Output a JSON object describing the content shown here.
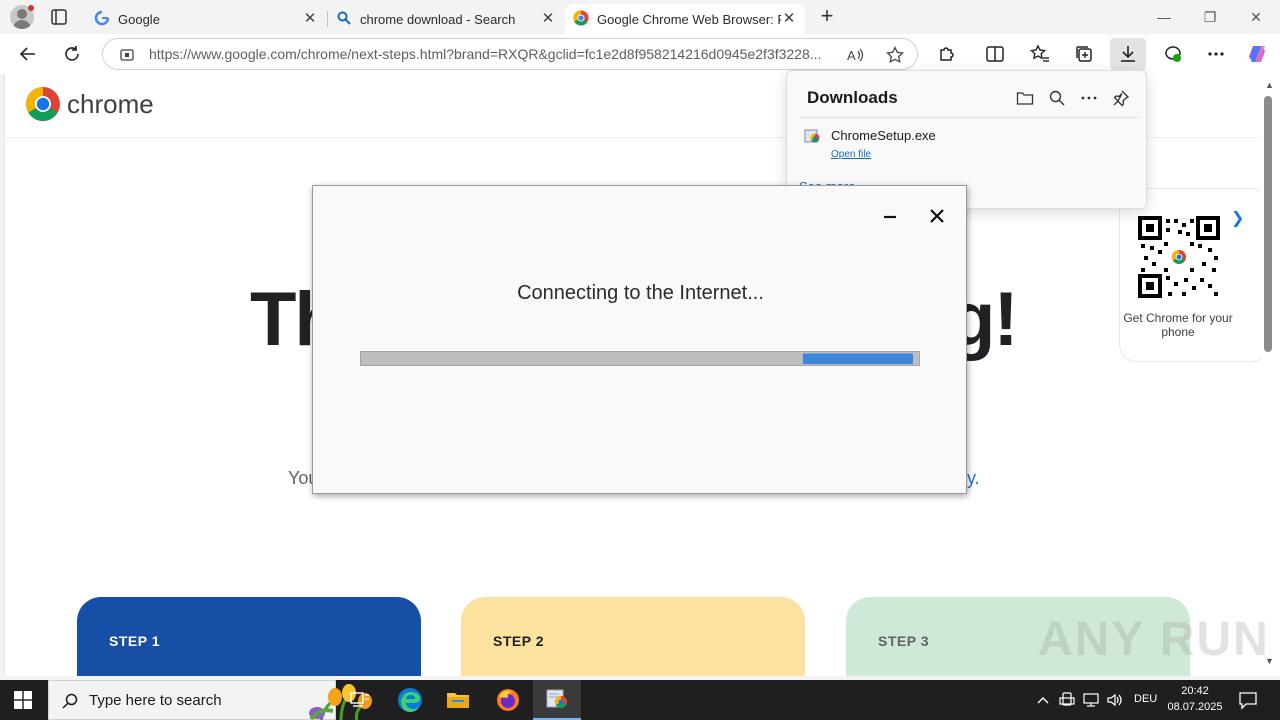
{
  "tabs": [
    {
      "title": "Google",
      "favicon": "google-g-icon",
      "active": false
    },
    {
      "title": "chrome download - Search",
      "favicon": "bing-search-icon",
      "active": false
    },
    {
      "title": "Google Chrome Web Browser: Fir",
      "favicon": "chrome-logo-icon",
      "active": true
    }
  ],
  "address": {
    "url": "https://www.google.com/chrome/next-steps.html?brand=RXQR&gclid=fc1e2d8f958214216d0945e2f3f3228..."
  },
  "page": {
    "logo_text": "chrome",
    "hero_left": "Th",
    "hero_right": "g!",
    "subtitle_left": "You",
    "subtitle_right": "y.",
    "qr_caption": "Get Chrome for your phone",
    "steps": [
      {
        "label": "STEP 1",
        "color": "#174ea6",
        "text_color": "#ffffff"
      },
      {
        "label": "STEP 2",
        "color": "#fce29f",
        "text_color": "#202124"
      },
      {
        "label": "STEP 3",
        "color": "#ceead6",
        "text_color": "#202124"
      }
    ]
  },
  "downloads": {
    "title": "Downloads",
    "items": [
      {
        "filename": "ChromeSetup.exe",
        "action": "Open file"
      }
    ],
    "see_more": "See more"
  },
  "installer": {
    "status": "Connecting to the Internet...",
    "progress_segment_start": 0.793,
    "progress_segment_end": 0.991
  },
  "watermark": "ANY RUN",
  "taskbar": {
    "search_placeholder": "Type here to search",
    "language": "DEU",
    "time": "20:42",
    "date": "08.07.2025"
  },
  "colors": {
    "accent_blue": "#1a73e8",
    "progress_blue": "#3d86dc",
    "link_blue": "#0f6cbd"
  }
}
